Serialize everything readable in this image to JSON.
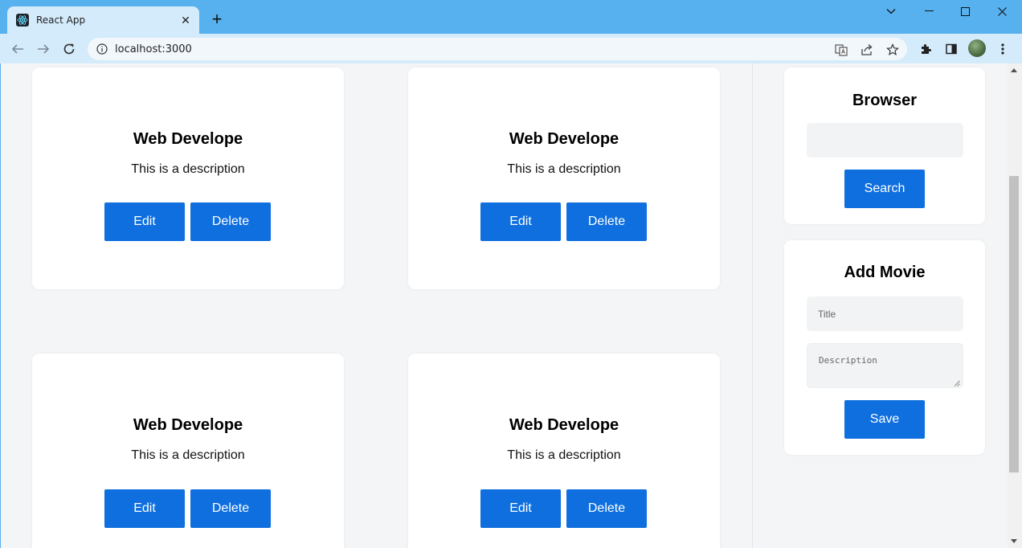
{
  "browser": {
    "tab_title": "React App",
    "url": "localhost:3000",
    "new_tab_symbol": "+",
    "close_symbol": "✕"
  },
  "movies": [
    {
      "title": "Web Develope",
      "description": "This is a description",
      "edit_label": "Edit",
      "delete_label": "Delete"
    },
    {
      "title": "Web Develope",
      "description": "This is a description",
      "edit_label": "Edit",
      "delete_label": "Delete"
    },
    {
      "title": "Web Develope",
      "description": "This is a description",
      "edit_label": "Edit",
      "delete_label": "Delete"
    },
    {
      "title": "Web Develope",
      "description": "This is a description",
      "edit_label": "Edit",
      "delete_label": "Delete"
    }
  ],
  "browser_panel": {
    "title": "Browser",
    "search_value": "",
    "search_label": "Search"
  },
  "add_movie": {
    "title": "Add Movie",
    "title_placeholder": "Title",
    "description_placeholder": "Description",
    "save_label": "Save"
  },
  "colors": {
    "primary_button": "#0f6fde",
    "tab_strip": "#57b1ee",
    "page_background": "#f4f5f7"
  },
  "icons": [
    "react-favicon-icon",
    "close-icon",
    "plus-icon",
    "chevron-down-icon",
    "minimize-icon",
    "maximize-icon",
    "back-arrow-icon",
    "forward-arrow-icon",
    "reload-icon",
    "info-icon",
    "translate-icon",
    "share-icon",
    "star-icon",
    "extensions-icon",
    "side-panel-icon",
    "menu-icon"
  ]
}
